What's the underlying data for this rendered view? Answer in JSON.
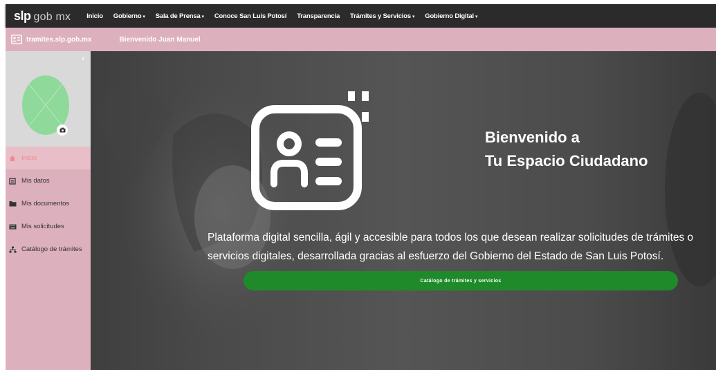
{
  "brand": {
    "primary": "slp",
    "secondary": "gob mx"
  },
  "nav": [
    {
      "label": "Inicio",
      "dropdown": false
    },
    {
      "label": "Gobierno",
      "dropdown": true
    },
    {
      "label": "Sala de Prensa",
      "dropdown": true
    },
    {
      "label": "Conoce San Luis Potosí",
      "dropdown": false
    },
    {
      "label": "Transparencia",
      "dropdown": false
    },
    {
      "label": "Trámites y Servicios",
      "dropdown": true
    },
    {
      "label": "Gobierno Digital",
      "dropdown": true
    }
  ],
  "subbar": {
    "domain": "tramites.slp.gob.mx",
    "welcome": "Bienvenido Juan Manuel"
  },
  "sidebar": {
    "collapse_icon": "chevron-left-icon",
    "items": [
      {
        "label": "Inicio",
        "icon": "home-icon",
        "active": true
      },
      {
        "label": "Mis datos",
        "icon": "id-card-icon",
        "active": false
      },
      {
        "label": "Mis documentos",
        "icon": "folder-icon",
        "active": false
      },
      {
        "label": "Mis solicitudes",
        "icon": "keyboard-icon",
        "active": false
      },
      {
        "label": "Catálogo de trámites",
        "icon": "sitemap-icon",
        "active": false
      }
    ]
  },
  "hero": {
    "title_line1": "Bienvenido a",
    "title_line2": "Tu Espacio Ciudadano",
    "description": "Plataforma digital sencilla, ágil y accesible para todos los que desean realizar solicitudes de trámites o servicios digitales, desarrollada gracias al esfuerzo del Gobierno del Estado de San Luis Potosí.",
    "cta_label": "Catálogo de trámites y servicios"
  },
  "colors": {
    "topnav": "#2b2b2b",
    "accent_pink": "#dcb0bd",
    "active_text": "#f08a8a",
    "cta_green": "#1f8a2a",
    "avatar_green": "#8fd99a"
  }
}
